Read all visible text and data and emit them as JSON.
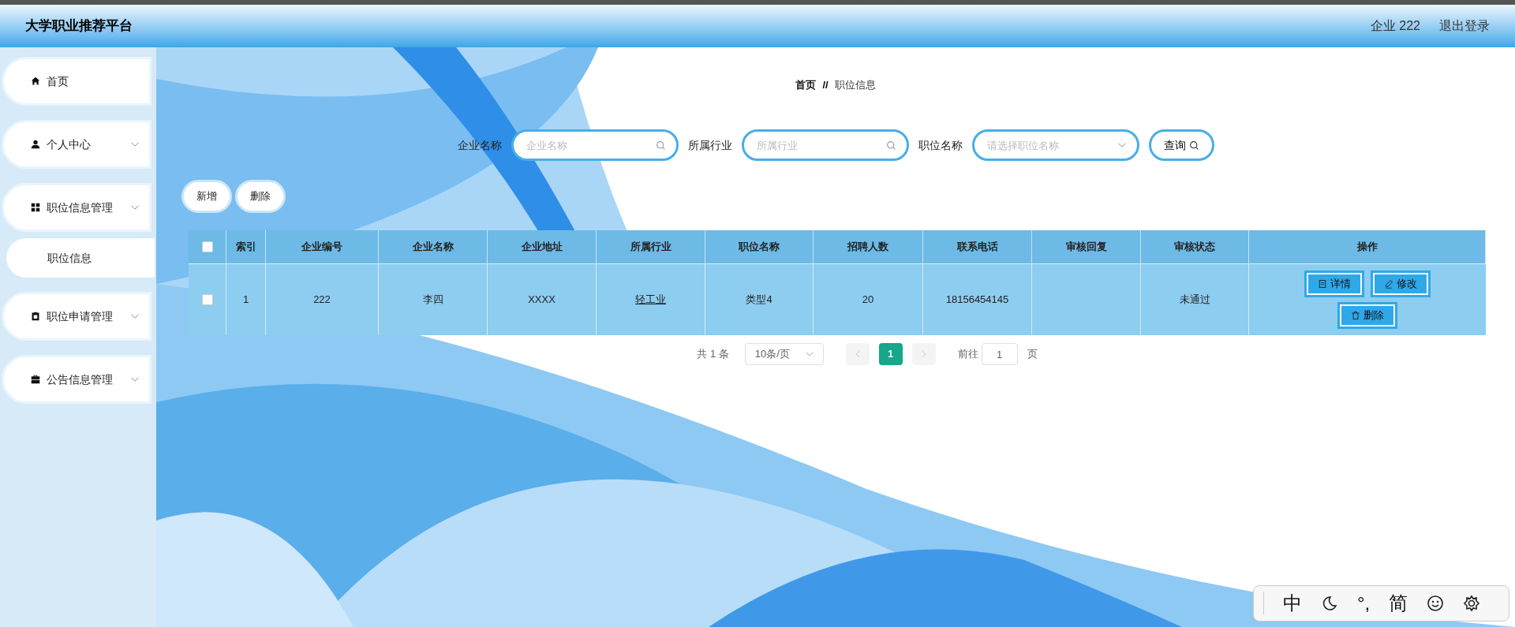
{
  "header": {
    "title": "大学职业推荐平台",
    "user": "企业 222",
    "logout": "退出登录"
  },
  "sidebar": {
    "items": [
      {
        "label": "首页",
        "expandable": false
      },
      {
        "label": "个人中心",
        "expandable": true
      },
      {
        "label": "职位信息管理",
        "expandable": true,
        "children": [
          {
            "label": "职位信息"
          }
        ]
      },
      {
        "label": "职位申请管理",
        "expandable": true
      },
      {
        "label": "公告信息管理",
        "expandable": true
      }
    ]
  },
  "breadcrumb": [
    "首页",
    "职位信息"
  ],
  "breadcrumb_separator": "//",
  "search": {
    "fields": [
      {
        "label": "企业名称",
        "placeholder": "企业名称",
        "kind": "input"
      },
      {
        "label": "所属行业",
        "placeholder": "所属行业",
        "kind": "input"
      },
      {
        "label": "职位名称",
        "placeholder": "请选择职位名称",
        "kind": "select"
      }
    ],
    "button": "查询"
  },
  "actions": [
    "新增",
    "删除"
  ],
  "table": {
    "select_all_checked": false,
    "columns": [
      "索引",
      "企业编号",
      "企业名称",
      "企业地址",
      "所属行业",
      "职位名称",
      "招聘人数",
      "联系电话",
      "审核回复",
      "审核状态",
      "操作"
    ],
    "rows": [
      {
        "checked": false,
        "cells": [
          "1",
          "222",
          "李四",
          "XXXX",
          "轻工业",
          "类型4",
          "20",
          "18156454145",
          "",
          "未通过"
        ],
        "actions": [
          "详情",
          "修改",
          "删除"
        ]
      }
    ]
  },
  "pagination": {
    "total": "共 1 条",
    "page_size": "10条/页",
    "pages": [
      {
        "label": "1",
        "selected": true
      }
    ],
    "goto_label": "前往",
    "goto_value": "1",
    "goto_suffix": "页"
  },
  "ime_toolbar": {
    "items": [
      {
        "kind": "text",
        "label": "中"
      },
      {
        "kind": "moon"
      },
      {
        "kind": "text",
        "label": "°,"
      },
      {
        "kind": "text",
        "label": "简"
      },
      {
        "kind": "smile"
      },
      {
        "kind": "gear"
      }
    ]
  }
}
